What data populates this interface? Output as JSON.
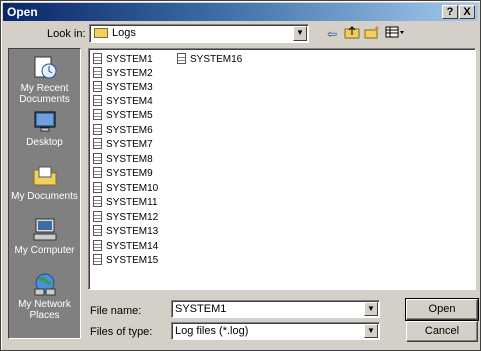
{
  "window": {
    "title": "Open",
    "help_label": "?",
    "close_label": "X"
  },
  "lookin": {
    "label": "Look in:",
    "value": "Logs"
  },
  "toolbar": {
    "icons": [
      "back-arrow-icon",
      "up-folder-icon",
      "new-folder-icon",
      "view-menu-icon"
    ]
  },
  "places": [
    {
      "label": "My Recent Documents",
      "icon": "recent-documents-icon"
    },
    {
      "label": "Desktop",
      "icon": "desktop-icon"
    },
    {
      "label": "My Documents",
      "icon": "my-documents-icon"
    },
    {
      "label": "My Computer",
      "icon": "my-computer-icon"
    },
    {
      "label": "My Network Places",
      "icon": "network-places-icon"
    }
  ],
  "files": [
    "SYSTEM1",
    "SYSTEM2",
    "SYSTEM3",
    "SYSTEM4",
    "SYSTEM5",
    "SYSTEM6",
    "SYSTEM7",
    "SYSTEM8",
    "SYSTEM9",
    "SYSTEM10",
    "SYSTEM11",
    "SYSTEM12",
    "SYSTEM13",
    "SYSTEM14",
    "SYSTEM15",
    "SYSTEM16"
  ],
  "filename": {
    "label": "File name:",
    "value": "SYSTEM1"
  },
  "filetype": {
    "label": "Files of type:",
    "value": "Log files (*.log)"
  },
  "buttons": {
    "open": "Open",
    "cancel": "Cancel"
  },
  "colors": {
    "title_gradient_start": "#0a246a",
    "title_gradient_end": "#a6caf0",
    "face": "#d4d0c8",
    "places_bar": "#808080"
  }
}
